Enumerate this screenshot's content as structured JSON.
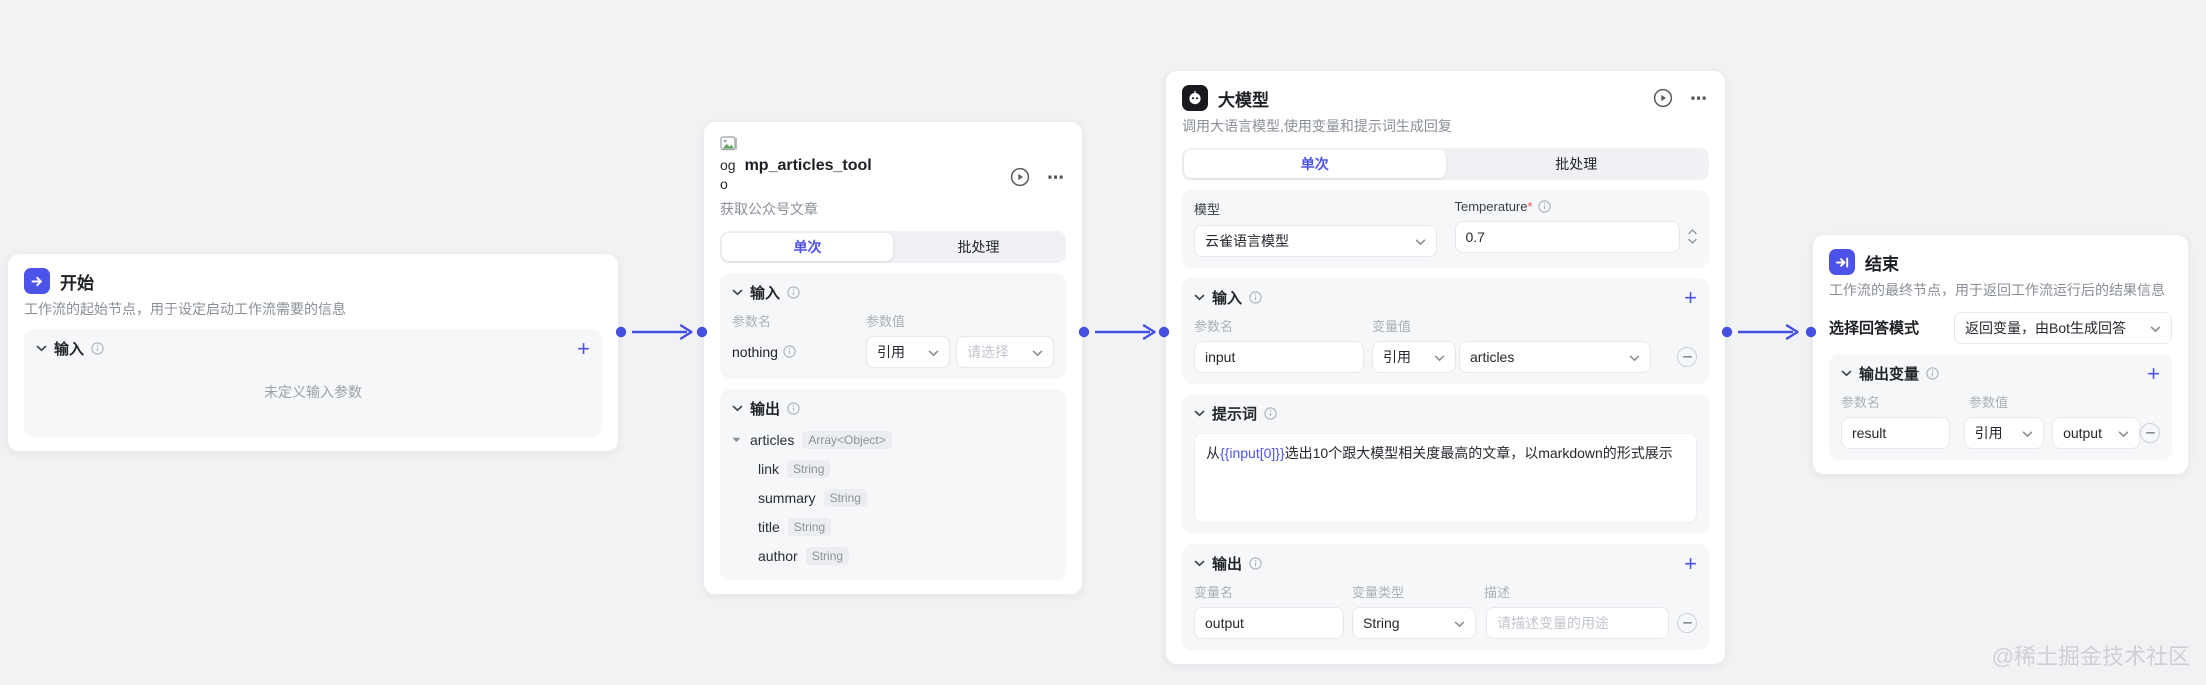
{
  "icons": {
    "more": "⋯",
    "plus": "+"
  },
  "tabs": {
    "single": "单次",
    "batch": "批处理"
  },
  "watermark": "@稀土掘金技术社区",
  "colors": {
    "accent": "#4d53e8",
    "canvas_bg": "#f1f2f4"
  },
  "nodes": {
    "start": {
      "title": "开始",
      "description": "工作流的起始节点，用于设定启动工作流需要的信息",
      "input": {
        "label": "输入",
        "empty_text": "未定义输入参数"
      }
    },
    "tool": {
      "icon_alt_top": "og",
      "icon_alt_bottom": "o",
      "title": "mp_articles_tool",
      "description": "获取公众号文章",
      "input": {
        "label": "输入",
        "col_name": "参数名",
        "col_value": "参数值",
        "row": {
          "name": "nothing",
          "method": "引用",
          "value_placeholder": "请选择"
        }
      },
      "output": {
        "label": "输出",
        "tree": {
          "root_name": "articles",
          "root_type": "Array<Object>",
          "children": [
            {
              "name": "link",
              "type": "String"
            },
            {
              "name": "summary",
              "type": "String"
            },
            {
              "name": "title",
              "type": "String"
            },
            {
              "name": "author",
              "type": "String"
            }
          ]
        }
      }
    },
    "llm": {
      "title": "大模型",
      "description": "调用大语言模型,使用变量和提示词生成回复",
      "model": {
        "label": "模型",
        "value": "云雀语言模型"
      },
      "temperature": {
        "label": "Temperature",
        "required_mark": "*",
        "value": "0.7"
      },
      "input": {
        "label": "输入",
        "col_name": "参数名",
        "col_value": "变量值",
        "row": {
          "name_value": "input",
          "method": "引用",
          "ref_value": "articles"
        }
      },
      "prompt": {
        "label": "提示词",
        "text_prefix": "从",
        "text_variable": "{{input[0]}}",
        "text_suffix": "选出10个跟大模型相关度最高的文章，以markdown的形式展示"
      },
      "output": {
        "label": "输出",
        "col_name": "变量名",
        "col_type": "变量类型",
        "col_desc": "描述",
        "row": {
          "name_value": "output",
          "type": "String",
          "desc_placeholder": "请描述变量的用途"
        }
      }
    },
    "end": {
      "title": "结束",
      "description": "工作流的最终节点，用于返回工作流运行后的结果信息",
      "answer_mode": {
        "label": "选择回答模式",
        "value": "返回变量，由Bot生成回答"
      },
      "output": {
        "label": "输出变量",
        "col_name": "参数名",
        "col_value": "参数值",
        "row": {
          "name_value": "result",
          "method": "引用",
          "ref_value": "output"
        }
      }
    }
  }
}
